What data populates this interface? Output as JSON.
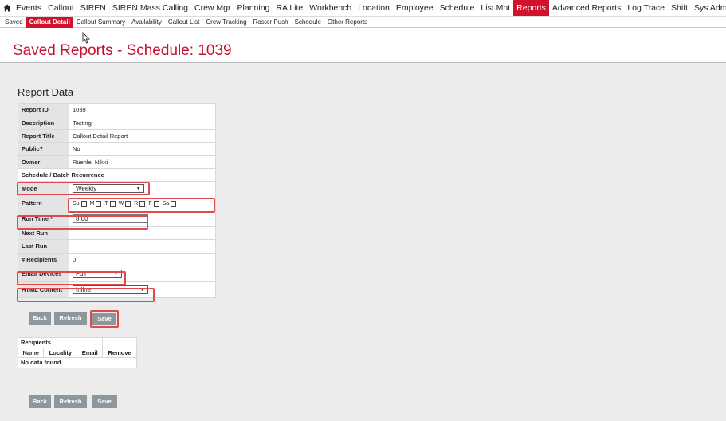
{
  "topnav": {
    "items": [
      "Events",
      "Callout",
      "SIREN",
      "SIREN Mass Calling",
      "Crew Mgr",
      "Planning",
      "RA Lite",
      "Workbench",
      "Location",
      "Employee",
      "Schedule",
      "List Mnt",
      "Reports",
      "Advanced Reports",
      "Log Trace",
      "Shift",
      "Sys Admin"
    ],
    "active": "Reports"
  },
  "subnav": {
    "items": [
      "Saved",
      "Callout Detail",
      "Callout Summary",
      "Availability",
      "Callout List",
      "Crew Tracking",
      "Roster Push",
      "Schedule",
      "Other Reports"
    ],
    "active": "Callout Detail"
  },
  "page_title": "Saved Reports - Schedule: 1039",
  "report_data": {
    "title": "Report Data",
    "report_id_label": "Report ID",
    "report_id": "1039",
    "description_label": "Description",
    "description": "Testing",
    "report_title_label": "Report Title",
    "report_title": "Callout Detail Report",
    "public_label": "Public?",
    "public": "No",
    "owner_label": "Owner",
    "owner": "Ruehle, Nikki",
    "recurrence_label": "Schedule / Batch Recurrence",
    "mode_label": "Mode",
    "mode_value": "Weekly",
    "pattern_label": "Pattern",
    "pattern_days": [
      "Su",
      "M",
      "T",
      "W",
      "R",
      "F",
      "Sa"
    ],
    "run_time_label": "Run Time *",
    "run_time_value": "8:00",
    "next_run_label": "Next Run",
    "next_run": "",
    "last_run_label": "Last Run",
    "last_run": "",
    "recipients_count_label": "# Recipients",
    "recipients_count": "0",
    "email_devices_label": "Email Devices",
    "email_devices_value": "Full",
    "html_content_label": "HTML Content",
    "html_content_value": "Inline"
  },
  "buttons": {
    "back": "Back",
    "refresh": "Refresh",
    "save": "Save"
  },
  "recipients": {
    "title": "Recipients",
    "columns": [
      "Name",
      "Locality",
      "Email",
      "Remove"
    ],
    "empty": "No data found."
  },
  "colors": {
    "accent": "#d0122d",
    "highlight": "#e04a4a",
    "button": "#8e979c"
  }
}
